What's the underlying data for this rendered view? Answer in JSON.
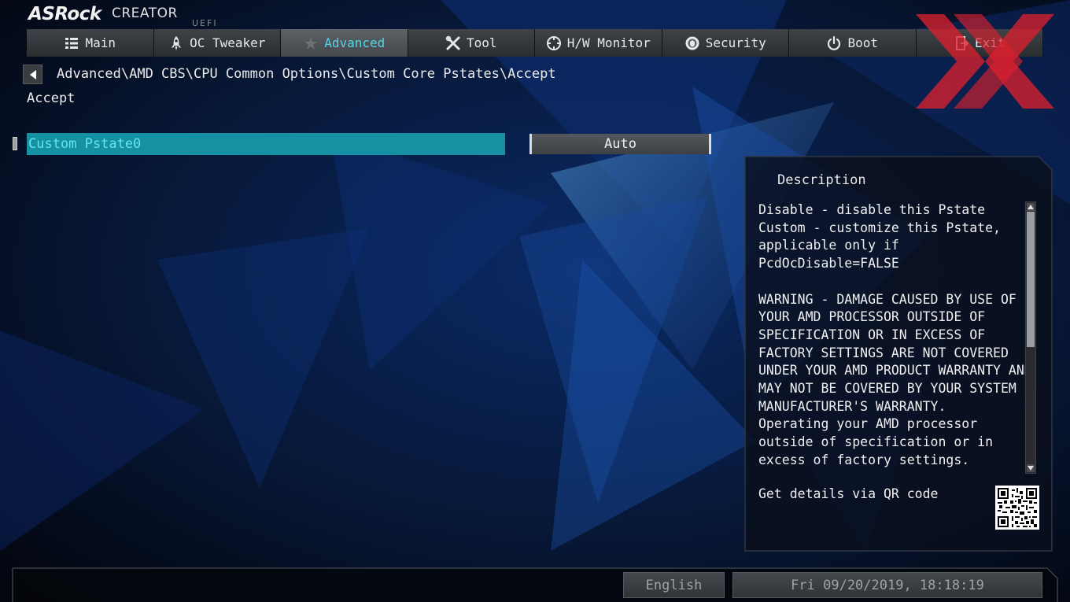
{
  "logo": {
    "brand": "ASRock",
    "product": "CREATOR",
    "firmware": "UEFI"
  },
  "nav": {
    "tabs": [
      {
        "label": "Main",
        "icon": "list-icon",
        "active": false
      },
      {
        "label": "OC Tweaker",
        "icon": "rocket-icon",
        "active": false
      },
      {
        "label": "Advanced",
        "icon": "star-icon",
        "active": true
      },
      {
        "label": "Tool",
        "icon": "tools-icon",
        "active": false
      },
      {
        "label": "H/W Monitor",
        "icon": "crosshair-icon",
        "active": false
      },
      {
        "label": "Security",
        "icon": "shield-icon",
        "active": false
      },
      {
        "label": "Boot",
        "icon": "power-icon",
        "active": false
      },
      {
        "label": "Exit",
        "icon": "exit-icon",
        "active": false
      }
    ]
  },
  "breadcrumb": "Advanced\\AMD CBS\\CPU Common Options\\Custom Core Pstates\\Accept",
  "page_title": "Accept",
  "setting": {
    "label": "Custom Pstate0",
    "value": "Auto"
  },
  "description": {
    "title": "Description",
    "text": "Disable - disable this Pstate\nCustom - customize this Pstate,\napplicable only if\nPcdOcDisable=FALSE\n\nWARNING - DAMAGE CAUSED BY USE OF\nYOUR AMD PROCESSOR OUTSIDE OF\nSPECIFICATION OR IN EXCESS OF\nFACTORY SETTINGS ARE NOT COVERED\nUNDER YOUR AMD PRODUCT WARRANTY AND\nMAY NOT BE COVERED BY YOUR SYSTEM\nMANUFACTURER'S WARRANTY.\nOperating your AMD processor\noutside of specification or in\nexcess of factory settings.",
    "qr_label": "Get details via QR code"
  },
  "footer": {
    "language": "English",
    "datetime": "Fri 09/20/2019, 18:18:19"
  },
  "colors": {
    "accent": "#52d6e6",
    "highlight_row": "#1690a3",
    "watermark": "#d8202e"
  }
}
